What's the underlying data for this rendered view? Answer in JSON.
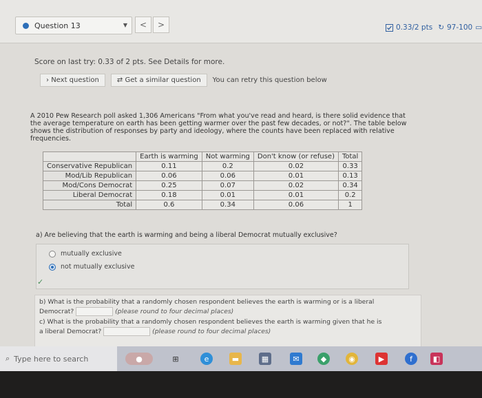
{
  "header": {
    "question_label": "Question 13",
    "prev_glyph": "<",
    "next_glyph": ">",
    "points": "0.33/2 pts",
    "attempts": "97-100"
  },
  "score_text": "Score on last try: 0.33 of 2 pts. See Details for more.",
  "buttons": {
    "next": "Next question",
    "similar": "Get a similar question",
    "retry_text": "You can retry this question below"
  },
  "prompt": "A 2010 Pew Research poll asked 1,306 Americans \"From what you've read and heard, is there solid evidence that the average temperature on earth has been getting warmer over the past few decades, or not?\". The table below shows the distribution of responses by party and ideology, where the counts have been replaced with relative frequencies.",
  "table": {
    "headers": [
      "",
      "Earth is warming",
      "Not warming",
      "Don't know (or refuse)",
      "Total"
    ],
    "rows": [
      [
        "Conservative Republican",
        "0.11",
        "0.2",
        "0.02",
        "0.33"
      ],
      [
        "Mod/Lib Republican",
        "0.06",
        "0.06",
        "0.01",
        "0.13"
      ],
      [
        "Mod/Cons Democrat",
        "0.25",
        "0.07",
        "0.02",
        "0.34"
      ],
      [
        "Liberal Democrat",
        "0.18",
        "0.01",
        "0.01",
        "0.2"
      ],
      [
        "Total",
        "0.6",
        "0.34",
        "0.06",
        "1"
      ]
    ]
  },
  "part_a": {
    "question": "a) Are believing that the earth is warming and being a liberal Democrat mutually exclusive?",
    "options": [
      "mutually exclusive",
      "not mutually exclusive"
    ],
    "selected_index": 1
  },
  "part_b": {
    "line1": "b) What is the probability that a randomly chosen respondent believes the earth is warming or is a liberal",
    "line2_prefix": "Democrat?",
    "hint": "(please round to four decimal places)"
  },
  "part_c": {
    "line1": "c) What is the probability that a randomly chosen respondent believes the earth is warming given that he is",
    "line2_prefix": "a liberal Democrat?",
    "hint": "(please round to four decimal places)"
  },
  "taskbar": {
    "search_placeholder": "Type here to search"
  },
  "colors": {
    "accent": "#2d6fb8",
    "check": "#4a8f5a"
  }
}
